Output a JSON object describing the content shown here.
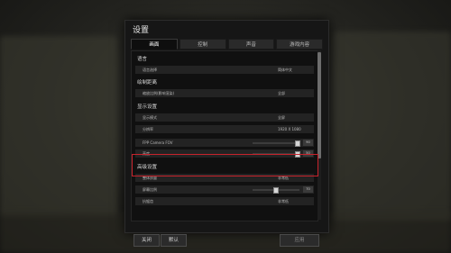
{
  "dialog": {
    "title": "设置"
  },
  "tabs": [
    {
      "label": "画面"
    },
    {
      "label": "控制"
    },
    {
      "label": "声音"
    },
    {
      "label": "游戏内容"
    }
  ],
  "sections": {
    "language": "语言",
    "render_scale": "绘制距离",
    "display": "显示设置",
    "advanced": "高级设置"
  },
  "rows": {
    "language": {
      "label": "语言选择",
      "value": "简体中文"
    },
    "render_scale": {
      "label": "缩放比例(影响渲染)",
      "value": "全部"
    },
    "display_mode": {
      "label": "显示模式",
      "value": "全屏"
    },
    "resolution": {
      "label": "分辨率",
      "value": "1920 X 1080"
    },
    "fpp_fov": {
      "label": "FPP Camera FOV",
      "value": "90",
      "level_pct": 96
    },
    "brightness": {
      "label": "亮度",
      "value": "50",
      "level_pct": 96
    },
    "overall_quality": {
      "label": "整体质量",
      "value": "非常低"
    },
    "screen_scale": {
      "label": "屏幕比例",
      "value": "70",
      "level_pct": 50
    },
    "anti_aliasing": {
      "label": "抗锯齿",
      "value": "非常低"
    }
  },
  "footer": {
    "close_label": "关闭",
    "default_label": "默认",
    "apply_label": "应用"
  },
  "colors": {
    "highlight": "#c8232c",
    "background": "#161616"
  }
}
